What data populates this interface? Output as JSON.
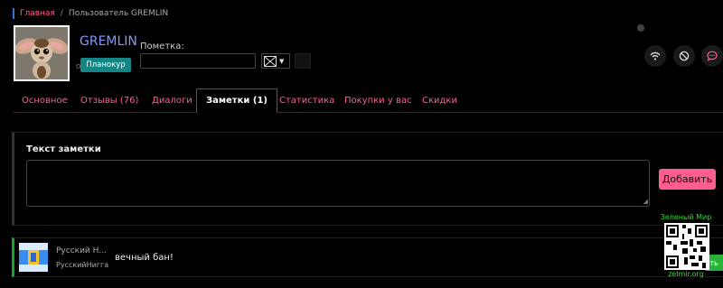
{
  "breadcrumb": {
    "home": "Главная",
    "separator": "/",
    "current": "Пользователь GREMLIN"
  },
  "profile": {
    "username": "GREMLIN",
    "status_dot": "o",
    "follow_button": "Планокур",
    "note_label": "Пометка:",
    "note_value": "",
    "icon_select": {
      "arrow": "▼"
    }
  },
  "actions": {
    "icons": [
      "wifi-icon",
      "block-icon",
      "message-icon"
    ]
  },
  "tabs": [
    {
      "label": "Основное",
      "active": false
    },
    {
      "label": "Отзывы (76)",
      "active": false
    },
    {
      "label": "Диалоги",
      "active": false
    },
    {
      "label": "Заметки (1)",
      "active": true
    },
    {
      "label": "Статистика",
      "active": false
    },
    {
      "label": "Покупки у вас",
      "active": false
    },
    {
      "label": "Скидки",
      "active": false
    }
  ],
  "note_form": {
    "title": "Текст заметки",
    "textarea_value": "",
    "submit_label": "Добавить"
  },
  "note_item": {
    "title": "Русский Н...",
    "subtitle": "РусскийНигга",
    "text": "вечный бан!",
    "green_label": "ть"
  },
  "overlay": {
    "top_text": "Зеленый Мир",
    "bottom_text": "zelmir.org"
  },
  "colors": {
    "accent": "#ff5d8f",
    "teal": "#128584",
    "link_blue": "#7f9bff",
    "green": "#1aa531",
    "background": "#000000"
  }
}
